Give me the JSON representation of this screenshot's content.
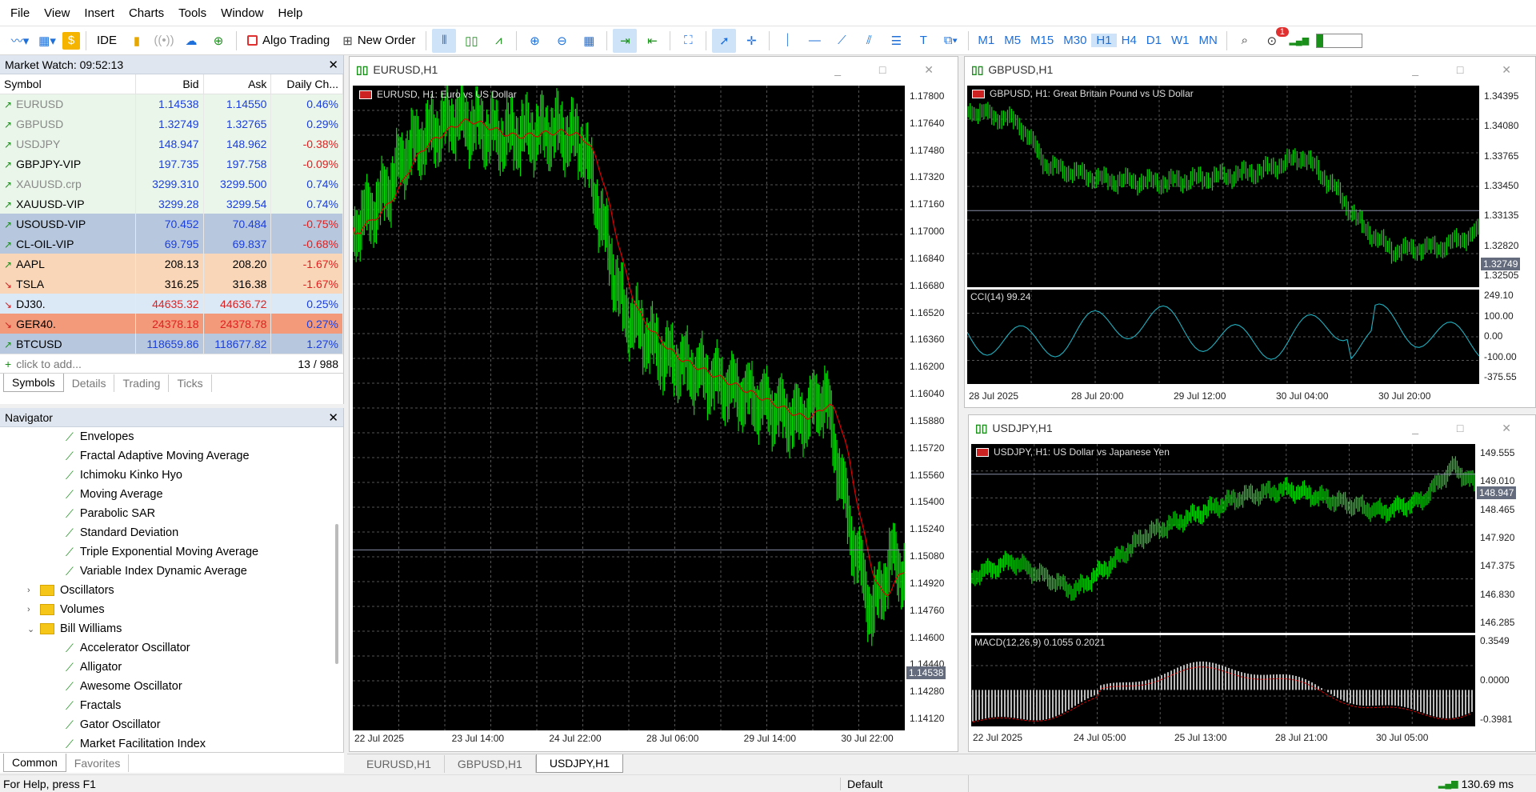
{
  "menu": [
    "File",
    "View",
    "Insert",
    "Charts",
    "Tools",
    "Window",
    "Help"
  ],
  "toolbar": {
    "ide": "IDE",
    "algo": "Algo Trading",
    "new_order": "New Order",
    "timeframes": [
      "M1",
      "M5",
      "M15",
      "M30",
      "H1",
      "H4",
      "D1",
      "W1",
      "MN"
    ],
    "active_tf": "H1",
    "notif": "1"
  },
  "market_watch": {
    "title": "Market Watch: 09:52:13",
    "headers": [
      "Symbol",
      "Bid",
      "Ask",
      "Daily Ch..."
    ],
    "rows": [
      {
        "symbol": "EURUSD",
        "bid": "1.14538",
        "ask": "1.14550",
        "change": "0.46%",
        "dir": "up"
      },
      {
        "symbol": "GBPUSD",
        "bid": "1.32749",
        "ask": "1.32765",
        "change": "0.29%",
        "dir": "up"
      },
      {
        "symbol": "USDJPY",
        "bid": "148.947",
        "ask": "148.962",
        "change": "-0.38%",
        "dir": "up"
      },
      {
        "symbol": "GBPJPY-VIP",
        "bid": "197.735",
        "ask": "197.758",
        "change": "-0.09%",
        "dir": "up"
      },
      {
        "symbol": "XAUUSD.crp",
        "bid": "3299.310",
        "ask": "3299.500",
        "change": "0.74%",
        "dir": "up"
      },
      {
        "symbol": "XAUUSD-VIP",
        "bid": "3299.28",
        "ask": "3299.54",
        "change": "0.74%",
        "dir": "up"
      },
      {
        "symbol": "USOUSD-VIP",
        "bid": "70.452",
        "ask": "70.484",
        "change": "-0.75%",
        "dir": "up"
      },
      {
        "symbol": "CL-OIL-VIP",
        "bid": "69.795",
        "ask": "69.837",
        "change": "-0.68%",
        "dir": "up"
      },
      {
        "symbol": "AAPL",
        "bid": "208.13",
        "ask": "208.20",
        "change": "-1.67%",
        "dir": "up"
      },
      {
        "symbol": "TSLA",
        "bid": "316.25",
        "ask": "316.38",
        "change": "-1.67%",
        "dir": "down"
      },
      {
        "symbol": "DJ30.",
        "bid": "44635.32",
        "ask": "44636.72",
        "change": "0.25%",
        "dir": "down"
      },
      {
        "symbol": "GER40.",
        "bid": "24378.18",
        "ask": "24378.78",
        "change": "0.27%",
        "dir": "down"
      },
      {
        "symbol": "BTCUSD",
        "bid": "118659.86",
        "ask": "118677.82",
        "change": "1.27%",
        "dir": "up"
      }
    ],
    "row_bg": [
      "#eaf6ea",
      "#eaf6ea",
      "#eaf6ea",
      "#eaf6ea",
      "#eaf6ea",
      "#eaf6ea",
      "#b7c8de",
      "#b7c8de",
      "#f9d6b8",
      "#f9d6b8",
      "#dbe9f7",
      "#f39a7a",
      "#b7c8de"
    ],
    "add_label": "click to add...",
    "count": "13 / 988",
    "tabs": [
      "Symbols",
      "Details",
      "Trading",
      "Ticks"
    ]
  },
  "navigator": {
    "title": "Navigator",
    "items": [
      {
        "label": "Envelopes",
        "type": "ind"
      },
      {
        "label": "Fractal Adaptive Moving Average",
        "type": "ind"
      },
      {
        "label": "Ichimoku Kinko Hyo",
        "type": "ind"
      },
      {
        "label": "Moving Average",
        "type": "ind"
      },
      {
        "label": "Parabolic SAR",
        "type": "ind"
      },
      {
        "label": "Standard Deviation",
        "type": "ind"
      },
      {
        "label": "Triple Exponential Moving Average",
        "type": "ind"
      },
      {
        "label": "Variable Index Dynamic Average",
        "type": "ind"
      },
      {
        "label": "Oscillators",
        "type": "folder",
        "chev": "›"
      },
      {
        "label": "Volumes",
        "type": "folder",
        "chev": "›"
      },
      {
        "label": "Bill Williams",
        "type": "folder",
        "chev": "⌄"
      },
      {
        "label": "Accelerator Oscillator",
        "type": "ind"
      },
      {
        "label": "Alligator",
        "type": "ind"
      },
      {
        "label": "Awesome Oscillator",
        "type": "ind"
      },
      {
        "label": "Fractals",
        "type": "ind"
      },
      {
        "label": "Gator Oscillator",
        "type": "ind"
      },
      {
        "label": "Market Facilitation Index",
        "type": "ind"
      }
    ],
    "tabs": [
      "Common",
      "Favorites"
    ]
  },
  "charts": {
    "eurusd": {
      "window": "EURUSD,H1",
      "label": "EURUSD, H1:  Euro vs US Dollar",
      "price": "1.14538",
      "yticks": [
        "1.17800",
        "1.17640",
        "1.17480",
        "1.17320",
        "1.17160",
        "1.17000",
        "1.16840",
        "1.16680",
        "1.16520",
        "1.16360",
        "1.16200",
        "1.16040",
        "1.15880",
        "1.15720",
        "1.15560",
        "1.15400",
        "1.15240",
        "1.15080",
        "1.14920",
        "1.14760",
        "1.14600",
        "1.14440",
        "1.14280",
        "1.14120"
      ],
      "xticks": [
        "22 Jul 2025",
        "23 Jul 14:00",
        "24 Jul 22:00",
        "28 Jul 06:00",
        "29 Jul 14:00",
        "30 Jul 22:00"
      ]
    },
    "gbpusd": {
      "window": "GBPUSD,H1",
      "label": "GBPUSD, H1:  Great Britain Pound vs US Dollar",
      "price": "1.32749",
      "yticks": [
        "1.34395",
        "1.34080",
        "1.33765",
        "1.33450",
        "1.33135",
        "1.32820",
        "1.32505"
      ],
      "ind_label": "CCI(14) 99.24",
      "ind_ticks": [
        "249.10",
        "100.00",
        "0.00",
        "-100.00",
        "-375.55"
      ],
      "xticks": [
        "28 Jul 2025",
        "28 Jul 20:00",
        "29 Jul 12:00",
        "30 Jul 04:00",
        "30 Jul 20:00"
      ]
    },
    "usdjpy": {
      "window": "USDJPY,H1",
      "label": "USDJPY, H1:  US Dollar vs Japanese Yen",
      "price": "148.947",
      "yticks": [
        "149.555",
        "149.010",
        "148.465",
        "147.920",
        "147.375",
        "146.830",
        "146.285"
      ],
      "ind_label": "MACD(12,26,9) 0.1055 0.2021",
      "ind_ticks": [
        "0.3549",
        "0.0000",
        "-0.3981"
      ],
      "xticks": [
        "22 Jul 2025",
        "24 Jul 05:00",
        "25 Jul 13:00",
        "28 Jul 21:00",
        "30 Jul 05:00"
      ]
    }
  },
  "chart_tabs": [
    "EURUSD,H1",
    "GBPUSD,H1",
    "USDJPY,H1"
  ],
  "active_chart_tab": "USDJPY,H1",
  "status": {
    "help": "For Help, press F1",
    "profile": "Default",
    "ping": "130.69 ms"
  }
}
